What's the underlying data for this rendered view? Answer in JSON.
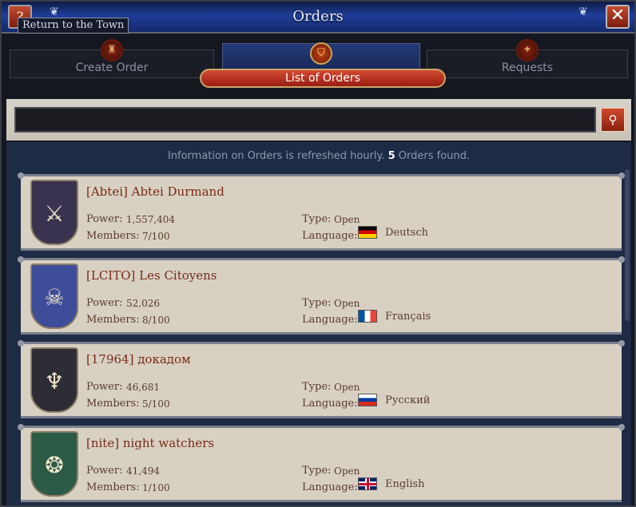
{
  "window": {
    "title": "Orders",
    "help_label": "?",
    "close_label": "✕",
    "tooltip": "Return to the Town"
  },
  "tabs": [
    {
      "label": "Create Order"
    },
    {
      "label": "List of Orders"
    },
    {
      "label": "Requests"
    }
  ],
  "search": {
    "value": "",
    "placeholder": "",
    "button_icon": "search-icon"
  },
  "info": {
    "prefix": "Information on Orders is refreshed hourly.",
    "count": "5",
    "suffix": "Orders found."
  },
  "orders": [
    {
      "name": "[Abtei] Abtei Durmand",
      "power_label": "Power:",
      "power": "1,557,404",
      "members_label": "Members:",
      "members": "7/100",
      "type_label": "Type:",
      "type": "Open",
      "language_label": "Language:",
      "language": "Deutsch",
      "flag": "germany-flag-icon",
      "crest_color": "#3a3350"
    },
    {
      "name": "[LCITO] Les Citoyens",
      "power_label": "Power:",
      "power": "52,026",
      "members_label": "Members:",
      "members": "8/100",
      "type_label": "Type:",
      "type": "Open",
      "language_label": "Language:",
      "language": "Français",
      "flag": "france-flag-icon",
      "crest_color": "#3e4d9a"
    },
    {
      "name": "[17964] докадом",
      "power_label": "Power:",
      "power": "46,681",
      "members_label": "Members:",
      "members": "5/100",
      "type_label": "Type:",
      "type": "Open",
      "language_label": "Language:",
      "language": "Русский",
      "flag": "russia-flag-icon",
      "crest_color": "#2e2d35"
    },
    {
      "name": "[nite] night watchers",
      "power_label": "Power:",
      "power": "41,494",
      "members_label": "Members:",
      "members": "1/100",
      "type_label": "Type:",
      "type": "Open",
      "language_label": "Language:",
      "language": "English",
      "flag": "uk-flag-icon",
      "crest_color": "#2b5a46"
    }
  ]
}
